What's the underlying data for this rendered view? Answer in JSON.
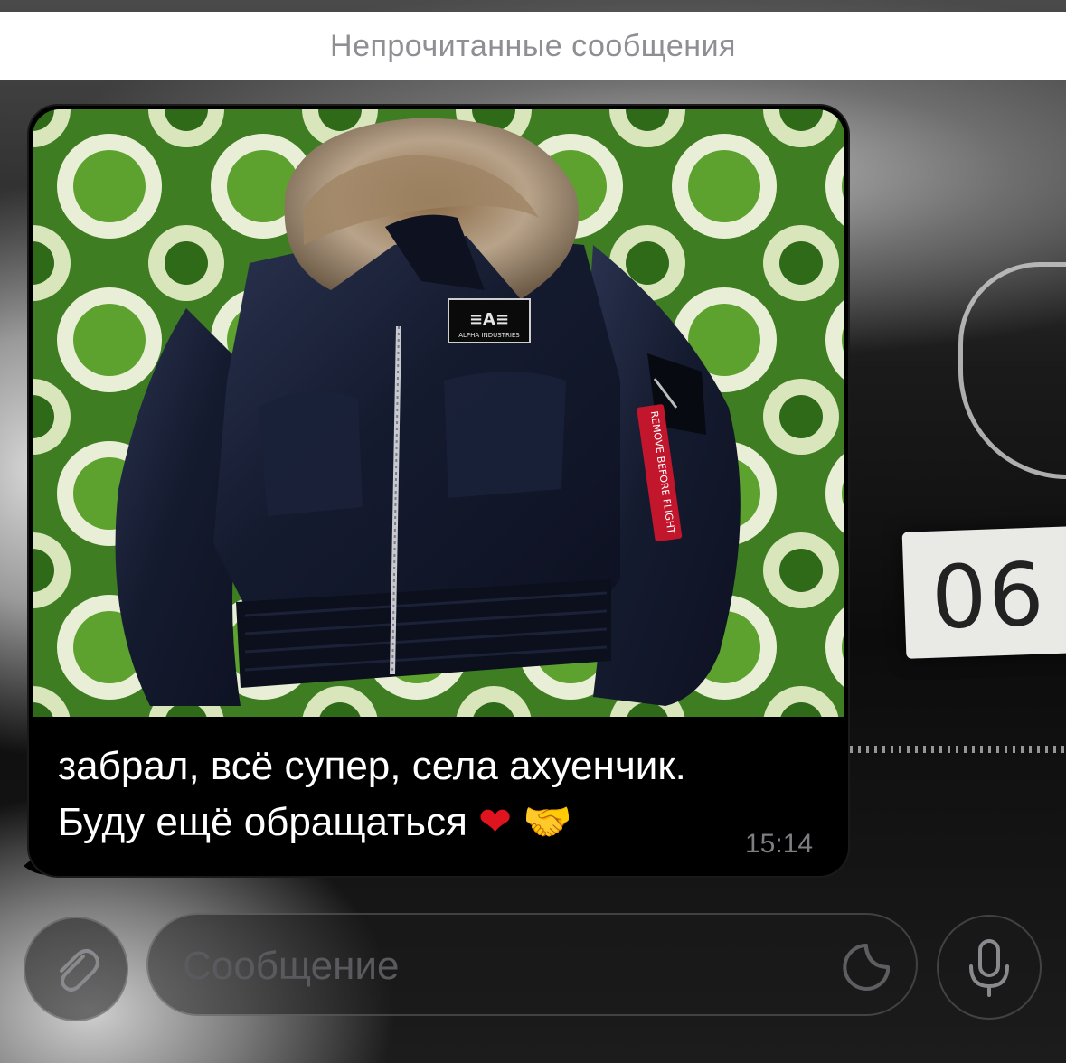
{
  "unread_banner": {
    "label": "Непрочитанные сообщения"
  },
  "wallpaper": {
    "plate_text": "06"
  },
  "message": {
    "photo": {
      "patch_text": "ALPHA INDUSTRIES",
      "tag_text": "REMOVE BEFORE FLIGHT"
    },
    "text_line_1": "забрал, всё супер, села ахуенчик.",
    "text_line_2": "Буду ещё обращаться",
    "emoji_1": "❤",
    "emoji_2": "🤝",
    "time": "15:14"
  },
  "composer": {
    "placeholder": "Сообщение",
    "attach_icon": "paperclip-icon",
    "sticker_icon": "sticker-icon",
    "mic_icon": "microphone-icon"
  },
  "colors": {
    "banner_bg": "#ffffff",
    "banner_text": "#8e8e93",
    "bubble_bg": "#000000",
    "time_text": "#7d7d82",
    "placeholder_text": "#5a5a5e"
  }
}
